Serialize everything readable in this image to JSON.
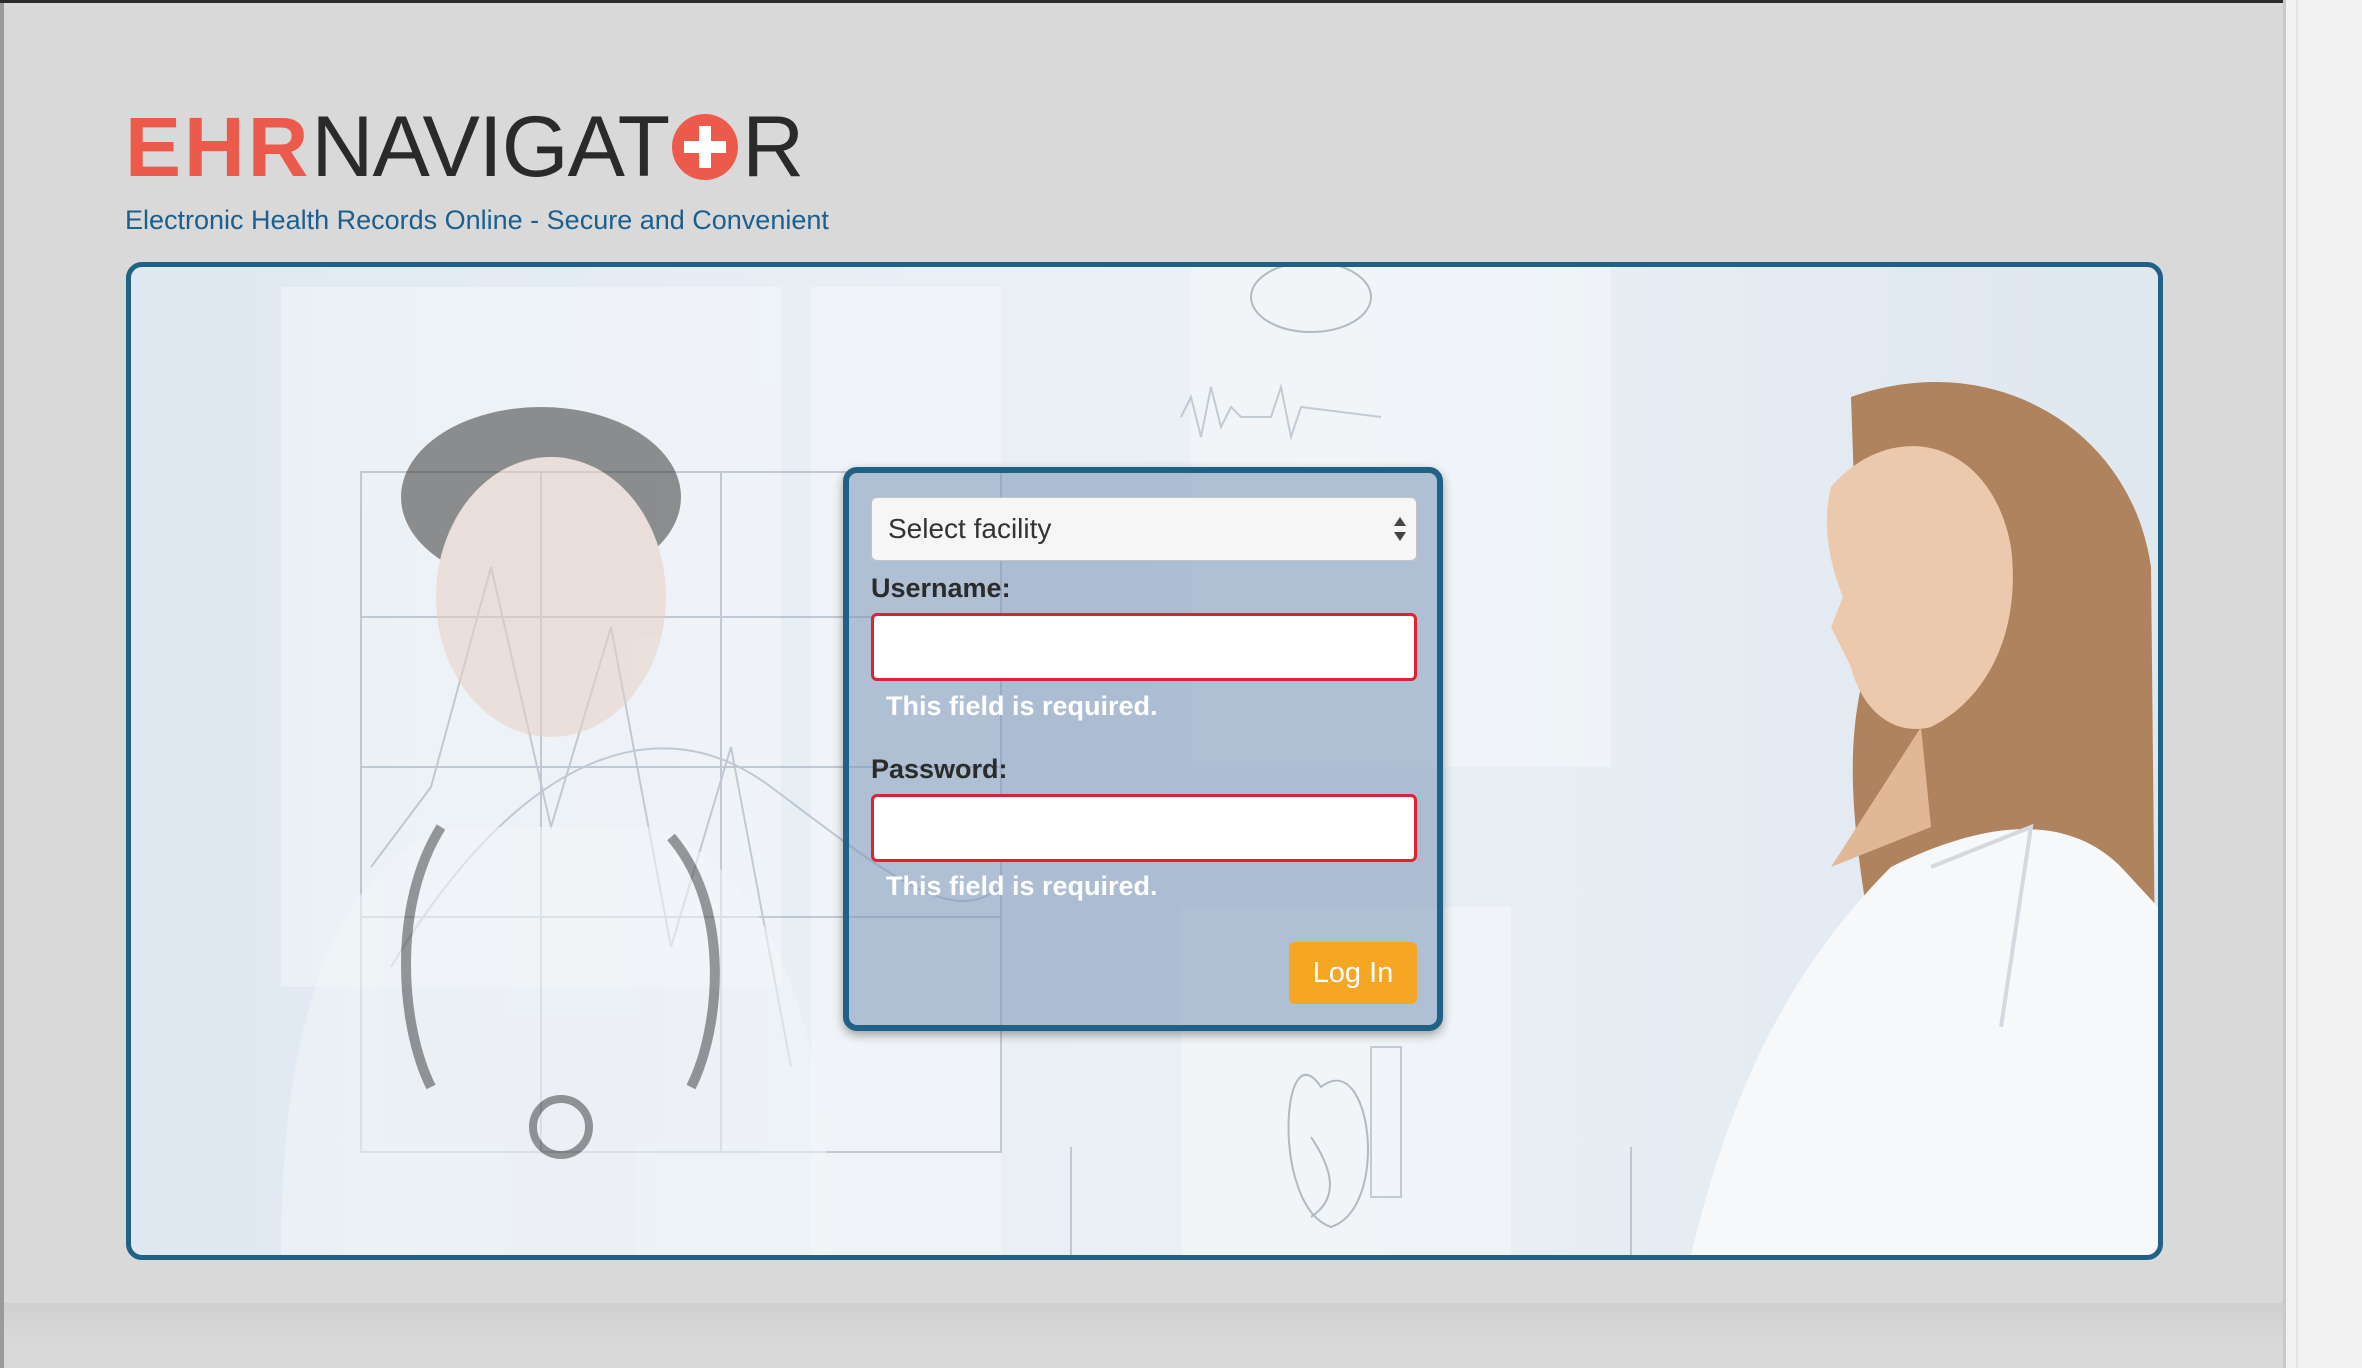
{
  "brand": {
    "logo_left": "EHR",
    "logo_right_a": "NAVIGAT",
    "logo_right_b": "R",
    "tagline": "Electronic Health Records Online - Secure and Convenient"
  },
  "login": {
    "facility_select": "Select facility",
    "username_label": "Username:",
    "username_error": "This field is required.",
    "password_label": "Password:",
    "password_error": "This field is required.",
    "submit_label": "Log In"
  },
  "colors": {
    "brand_red": "#ec5a4b",
    "frame_blue": "#1f6286",
    "tagline_blue": "#1b5f8f",
    "button_orange": "#f5a623",
    "error_red": "#e0212f"
  }
}
